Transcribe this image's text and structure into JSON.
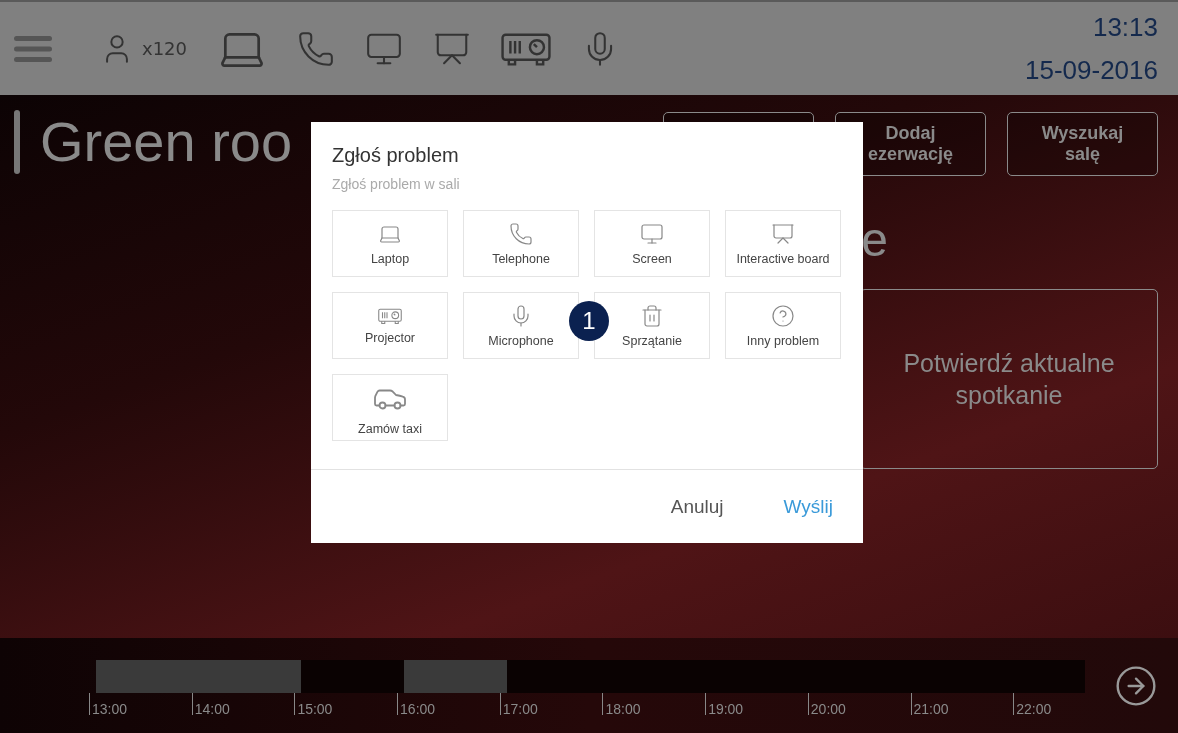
{
  "top_bar": {
    "capacity": "x120",
    "time": "13:13",
    "date": "15-09-2016"
  },
  "room": {
    "title": "Green roo",
    "heading_end": "e",
    "buttons": [
      {
        "lines": [
          "Dodaj",
          "ezerwację"
        ]
      },
      {
        "lines": [
          "Wyszukaj",
          "salę"
        ]
      }
    ],
    "confirm_button": "Potwierdź aktualne spotkanie"
  },
  "dialog": {
    "title": "Zgłoś problem",
    "subtitle": "Zgłoś problem w sali",
    "options": [
      {
        "label": "Laptop"
      },
      {
        "label": "Telephone"
      },
      {
        "label": "Screen"
      },
      {
        "label": "Interactive board"
      },
      {
        "label": "Projector"
      },
      {
        "label": "Microphone"
      },
      {
        "label": "Sprzątanie"
      },
      {
        "label": "Inny problem"
      },
      {
        "label": "Zamów taxi"
      }
    ],
    "cancel": "Anuluj",
    "send": "Wyślij"
  },
  "badge": "1",
  "timeline": {
    "slots": [
      {
        "label": "13:00",
        "busy": true
      },
      {
        "label": "14:00",
        "busy": true
      },
      {
        "label": "15:00",
        "busy": false
      },
      {
        "label": "16:00",
        "busy": true
      },
      {
        "label": "17:00",
        "busy": false
      },
      {
        "label": "18:00",
        "busy": false
      },
      {
        "label": "19:00",
        "busy": false
      },
      {
        "label": "20:00",
        "busy": false
      },
      {
        "label": "21:00",
        "busy": false
      },
      {
        "label": "22:00",
        "busy": false
      }
    ]
  }
}
